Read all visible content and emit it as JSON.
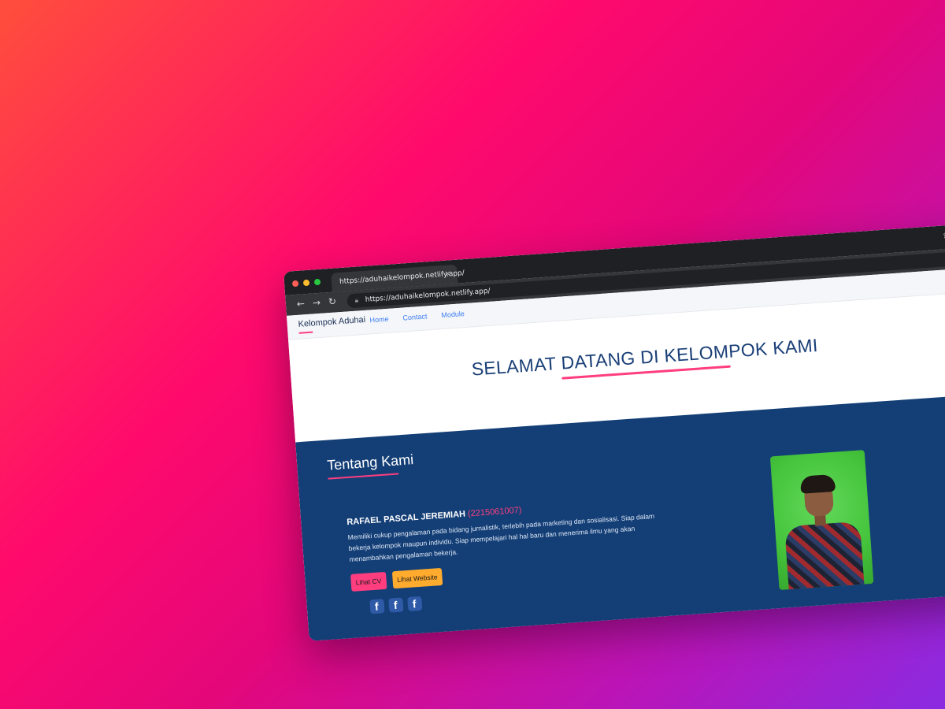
{
  "browser": {
    "tab_title": "https://aduhaikelompok.netlify.app/",
    "tab_close": "×",
    "url": "https://aduhaikelompok.netlify.app/",
    "nav_back": "←",
    "nav_forward": "→",
    "nav_reload": "↻",
    "icons": [
      "share-icon",
      "star-icon",
      "menu-icon"
    ]
  },
  "navbar": {
    "brand": "Kelompok Aduhai",
    "links": [
      "Home",
      "Contact",
      "Module"
    ]
  },
  "hero": {
    "title": "SELAMAT DATANG DI KELOMPOK KAMI"
  },
  "about": {
    "title": "Tentang Kami",
    "member": {
      "name": "RAFAEL PASCAL JEREMIAH",
      "id": "(2215061007)",
      "description": "Memiliki cukup pengalaman pada bidang jurnalistik, terlebih pada marketing dan sosialisasi. Siap dalam bekerja kelompok maupun individu. Siap mempelajari hal hal baru dan menerima ilmu yang akan menambahkan pengalaman bekerja.",
      "cv_button": "Lihat CV",
      "website_button": "Lihat Website",
      "socials": [
        "f",
        "f",
        "f"
      ]
    }
  },
  "colors": {
    "accent": "#ff3d7f",
    "navy": "#143f76",
    "link": "#3d7cf5",
    "orange": "#ffab2e"
  }
}
